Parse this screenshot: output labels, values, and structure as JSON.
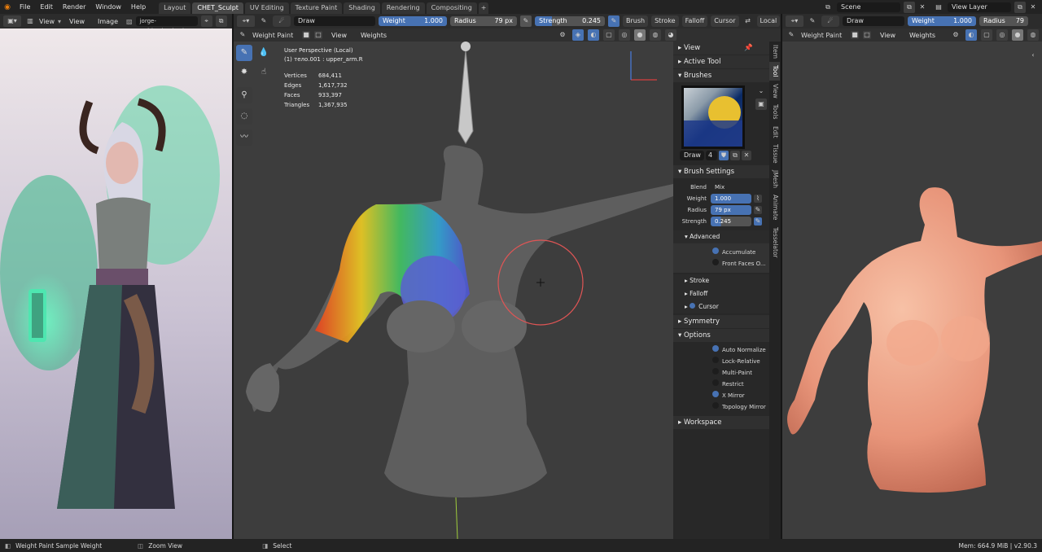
{
  "topbar": {
    "menus": [
      "File",
      "Edit",
      "Render",
      "Window",
      "Help"
    ],
    "tabs": [
      "Layout",
      "CHET_Sculpt",
      "UV Editing",
      "Texture Paint",
      "Shading",
      "Rendering",
      "Compositing"
    ],
    "active_tab": "CHET_Sculpt",
    "scene": "Scene",
    "view_layer": "View Layer"
  },
  "image_editor": {
    "view_label": "View",
    "menu": [
      "View",
      "Image"
    ],
    "image_name": "jorge-rodri...cheaker.jpg"
  },
  "tool_header": {
    "brush": "Draw",
    "weight_label": "Weight",
    "weight_value": "1.000",
    "radius_label": "Radius",
    "radius_value": "79 px",
    "strength_label": "Strength",
    "strength_value": "0.245",
    "menus": [
      "Brush",
      "Stroke",
      "Falloff",
      "Cursor"
    ],
    "orientation": "Local"
  },
  "viewport": {
    "mode": "Weight Paint",
    "menu": [
      "View",
      "Weights"
    ],
    "perspective": "User Perspective (Local)",
    "object": "(1) тело.001 : upper_arm.R",
    "stats": [
      {
        "label": "Vertices",
        "value": "684,411"
      },
      {
        "label": "Edges",
        "value": "1,617,732"
      },
      {
        "label": "Faces",
        "value": "933,397"
      },
      {
        "label": "Triangles",
        "value": "1,367,935"
      }
    ]
  },
  "sidebar": {
    "tabs": [
      "Item",
      "Tool",
      "View",
      "Tools",
      "Edit",
      "Tissue",
      "JMesh",
      "Animate",
      "Tesselator"
    ],
    "panels": {
      "view": "View",
      "active_tool": "Active Tool",
      "brushes": "Brushes",
      "brush_name": "Draw",
      "brush_users": "4",
      "brush_settings": "Brush Settings",
      "blend_label": "Blend",
      "blend_value": "Mix",
      "weight_label": "Weight",
      "weight_value": "1.000",
      "radius_label": "Radius",
      "radius_value": "79 px",
      "strength_label": "Strength",
      "strength_value": "0.245",
      "advanced": "Advanced",
      "accumulate": "Accumulate",
      "front_faces": "Front Faces O...",
      "stroke": "Stroke",
      "falloff": "Falloff",
      "cursor": "Cursor",
      "symmetry": "Symmetry",
      "options": "Options",
      "opt_items": [
        {
          "label": "Auto Normalize",
          "on": true
        },
        {
          "label": "Lock-Relative",
          "on": false
        },
        {
          "label": "Multi-Paint",
          "on": false
        },
        {
          "label": "Restrict",
          "on": false
        },
        {
          "label": "X Mirror",
          "on": true
        },
        {
          "label": "Topology Mirror",
          "on": false
        }
      ],
      "workspace": "Workspace"
    }
  },
  "right_view": {
    "brush": "Draw",
    "weight_label": "Weight",
    "weight_value": "1.000",
    "radius_label": "Radius",
    "radius_value": "79",
    "mode": "Weight Paint",
    "menu": [
      "View",
      "Weights"
    ]
  },
  "statusbar": {
    "left": "Weight Paint Sample Weight",
    "mid": "Zoom View",
    "select": "Select",
    "right": "Mem: 664.9 MiB | v2.90.3"
  },
  "colors": {
    "accent": "#4772b3",
    "bg": "#1d1d1d",
    "panel": "#303030",
    "header": "#2c2c2c",
    "viewport": "#3d3d3d",
    "brush_circle": "#e05555"
  }
}
